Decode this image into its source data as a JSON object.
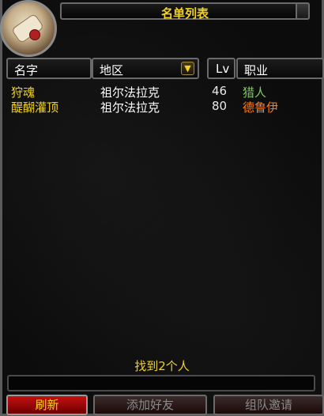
{
  "window": {
    "title": "名单列表"
  },
  "columns": {
    "name": "名字",
    "zone": "地区",
    "level": "Lv",
    "class": "职业"
  },
  "results": [
    {
      "name": "狩魂",
      "zone": "祖尔法拉克",
      "level": "46",
      "class": "猎人",
      "class_color": "#80c860"
    },
    {
      "name": "醍醐灌顶",
      "zone": "祖尔法拉克",
      "level": "80",
      "class": "德鲁伊",
      "class_color": "#ff7c1a"
    }
  ],
  "status": {
    "found_text": "找到2个人"
  },
  "buttons": {
    "refresh": "刷新",
    "add_friend": "添加好友",
    "group_invite": "组队邀请"
  },
  "colors": {
    "gold": "#f2d21e",
    "hunter": "#80c860",
    "druid": "#ff7c1a"
  }
}
